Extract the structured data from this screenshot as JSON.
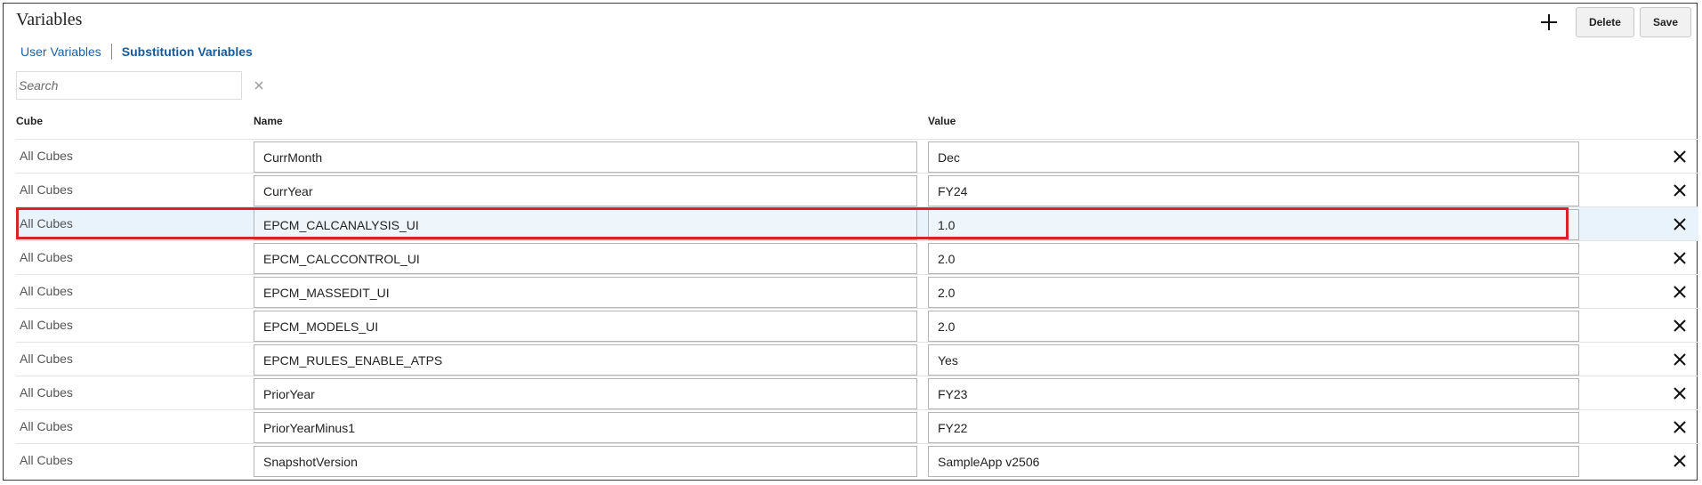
{
  "page": {
    "title": "Variables",
    "toolbar": {
      "add_icon": "plus-icon",
      "delete_label": "Delete",
      "save_label": "Save"
    },
    "tabs": [
      {
        "label": "User Variables",
        "active": false
      },
      {
        "label": "Substitution Variables",
        "active": true
      }
    ],
    "search": {
      "placeholder": "Search",
      "value": "",
      "clear_icon": "close-icon"
    }
  },
  "table": {
    "columns": {
      "cube": "Cube",
      "name": "Name",
      "value": "Value"
    },
    "rows": [
      {
        "cube": "All Cubes",
        "name": "CurrMonth",
        "value": "Dec"
      },
      {
        "cube": "All Cubes",
        "name": "CurrYear",
        "value": "FY24"
      },
      {
        "cube": "All Cubes",
        "name": "EPCM_CALCANALYSIS_UI",
        "value": "1.0",
        "selected": true
      },
      {
        "cube": "All Cubes",
        "name": "EPCM_CALCCONTROL_UI",
        "value": "2.0"
      },
      {
        "cube": "All Cubes",
        "name": "EPCM_MASSEDIT_UI",
        "value": "2.0"
      },
      {
        "cube": "All Cubes",
        "name": "EPCM_MODELS_UI",
        "value": "2.0"
      },
      {
        "cube": "All Cubes",
        "name": "EPCM_RULES_ENABLE_ATPS",
        "value": "Yes"
      },
      {
        "cube": "All Cubes",
        "name": "PriorYear",
        "value": "FY23"
      },
      {
        "cube": "All Cubes",
        "name": "PriorYearMinus1",
        "value": "FY22"
      },
      {
        "cube": "All Cubes",
        "name": "SnapshotVersion",
        "value": "SampleApp v2506"
      }
    ],
    "row_delete_icon": "close-icon"
  },
  "colors": {
    "link": "#1e5f9e",
    "selected_row": "#e9f3fb",
    "highlight_border": "#d9232b"
  }
}
